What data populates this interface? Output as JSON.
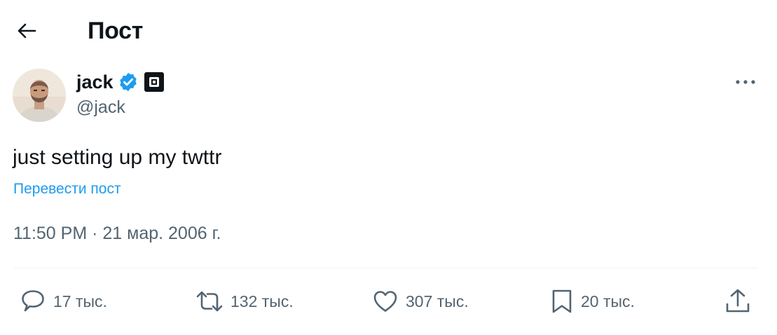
{
  "header": {
    "title": "Пост"
  },
  "author": {
    "name": "jack",
    "handle": "@jack"
  },
  "tweet": {
    "text": "just setting up my twttr",
    "translate_label": "Перевести пост",
    "time": "11:50 PM",
    "separator": "·",
    "date": "21 мар. 2006 г."
  },
  "actions": {
    "replies": "17 тыс.",
    "retweets": "132 тыс.",
    "likes": "307 тыс.",
    "bookmarks": "20 тыс."
  },
  "colors": {
    "accent": "#1d9bf0",
    "text": "#0f1419",
    "secondary": "#536471",
    "divider": "#eff3f4"
  }
}
